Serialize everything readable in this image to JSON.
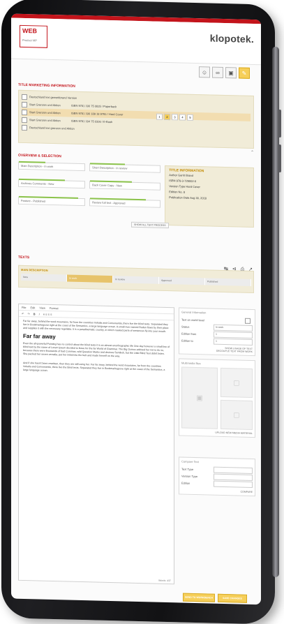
{
  "brand": "klopotek.",
  "logo": {
    "text": "WEB",
    "subtitle": "Product MP"
  },
  "marketing": {
    "title": "Title Marketing Information",
    "items": [
      {
        "label": "Deutschland lexi gewerkbrand Version",
        "isbn": ""
      },
      {
        "label": "Start Grenzen und Aktion",
        "isbn": "ISBN 9781 190 75 0835 / Paperback"
      },
      {
        "label": "Start Grenzen und Aktion",
        "isbn": "ISBN 9781 190 189 18 9793 / Hard Cover"
      },
      {
        "label": "Start Grenzen und Aktion",
        "isbn": "ISBN 9781 184 75 0306 / E-Book"
      },
      {
        "label": "Deutschland lexi grenzen und Aktion",
        "isbn": ""
      }
    ],
    "pages": [
      "1",
      "2",
      "3",
      "4",
      "5"
    ]
  },
  "overview": {
    "title": "Overview & Selection",
    "fields_left": [
      {
        "label": "Main Description - In work",
        "progress": 0.4
      },
      {
        "label": "Archives Comments - New",
        "progress": 0.7
      },
      {
        "label": "Feature - Published",
        "progress": 0.9
      }
    ],
    "fields_mid": [
      {
        "label": "Short Description - In review",
        "progress": 0.5
      },
      {
        "label": "Back Cover Copy - New",
        "progress": 0.6
      },
      {
        "label": "Review full text - Approved",
        "progress": 0.8
      }
    ],
    "show_all": "SHOW ALL TEXT PROCESS",
    "title_info": {
      "title": "Title Information",
      "lines": [
        "Author Gerrit Brand",
        "ISBN 978-3-729002-0",
        "Version Type Hard Cover",
        "Edition No. 8",
        "Publication Date Aug 30, 2018"
      ]
    }
  },
  "texts": {
    "title": "Texts",
    "main_label": "MAIN DESCRIPTION",
    "steps": [
      "New",
      "In work",
      "In review",
      "Approved",
      "Published"
    ],
    "editor_menu": [
      "File",
      "Edit",
      "View",
      "Format"
    ],
    "editor_paragraph_1": "Far far away, behind the word mountains, far from the countries Vokalia and Consonantia, there live the blind texts. Separated they live in Bookmarksgrove right at the coast of the Semantics, a large language ocean. A small river named Duden flows by their place and supplies it with the necessary regelialia. It is a paradisematic country, in which roasted parts of sentences fly into your mouth.",
    "editor_heading": "Far far away",
    "editor_paragraph_2": "Even the all-powerful Pointing has no control about the blind texts it is an almost unorthographic life One day however a small line of blind text by the name of Lorem Ipsum decided to leave for the far World of Grammar. The Big Oxmox advised her not to do so, because there were thousands of bad Commas, wild Question Marks and devious Semikoli, but the Little Blind Text didn't listen. She packed her seven versalia, put her initial into the belt and made herself on the way.",
    "editor_paragraph_3": "And if she hasn't been rewritten, then they are still using her. Far far away, behind the word mountains, far from the countries Vokalia and Consonantia, there live the blind texts. Separated they live in Bookmarksgrove right at the coast of the Semantics, a large language ocean.",
    "word_count": "Words: 437",
    "general_info": {
      "title": "General Information",
      "rows": [
        {
          "label": "Text on world level",
          "value": ""
        },
        {
          "label": "Status",
          "value": "In work"
        },
        {
          "label": "Edition from",
          "value": "1"
        },
        {
          "label": "Edition to",
          "value": "1"
        }
      ],
      "links": [
        "SHOW USAGE OF TEXT",
        "DECOUPLE TEXT FROM WORK"
      ]
    },
    "multimedia": {
      "title": "Multimedia files",
      "link": "UPLOAD NEW MEDIA MATERIAL"
    },
    "compare": {
      "title": "Compare Text",
      "rows": [
        "Text Type",
        "Version Type",
        "Edition"
      ],
      "link": "COMPARE"
    },
    "buttons": {
      "send": "SEND TO WORKBENCH",
      "save": "SAVE CHANGES"
    }
  }
}
